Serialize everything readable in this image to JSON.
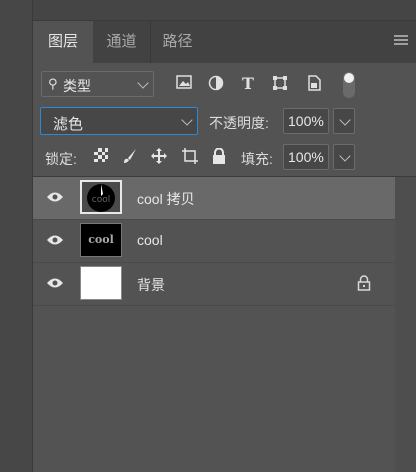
{
  "tabs": [
    {
      "label": "图层",
      "active": true
    },
    {
      "label": "通道",
      "active": false
    },
    {
      "label": "路径",
      "active": false
    }
  ],
  "filter": {
    "selected": "类型",
    "icons": [
      "image-filter-icon",
      "adjustment-filter-icon",
      "type-filter-icon",
      "shape-filter-icon",
      "smart-object-filter-icon"
    ],
    "toggle": "on"
  },
  "blend": {
    "mode": "滤色",
    "opacity_label": "不透明度:",
    "opacity_value": "100%"
  },
  "lock": {
    "label": "锁定:",
    "fill_label": "填充:",
    "fill_value": "100%"
  },
  "layers": [
    {
      "name": "cool 拷贝",
      "visible": true,
      "selected": true,
      "thumb": "dark-circle"
    },
    {
      "name": "cool",
      "visible": true,
      "selected": false,
      "thumb": "cool-text",
      "thumb_text": "cool"
    },
    {
      "name": "背景",
      "visible": true,
      "selected": false,
      "thumb": "white",
      "locked": true
    }
  ],
  "colors": {
    "panel_bg": "#535353",
    "selected_row": "#696969",
    "focus_border": "#2e88d6"
  }
}
